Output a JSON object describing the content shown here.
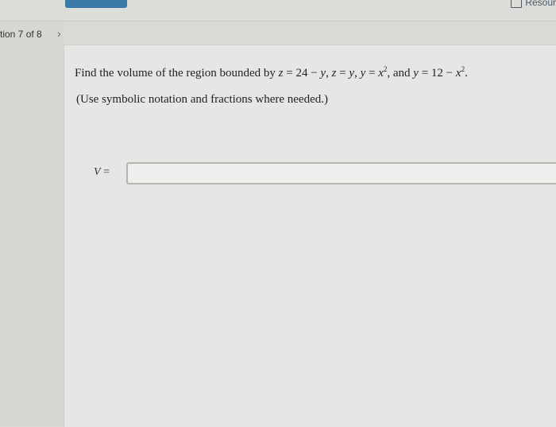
{
  "header": {
    "resources_label": "Resour"
  },
  "sidebar": {
    "question_nav": "tion 7 of 8",
    "next_arrow": "›"
  },
  "question": {
    "prefix": "Find the volume of the region bounded by ",
    "v_z": "z",
    "eq1": " = 24 − ",
    "v_y1": "y",
    "sep1": ", ",
    "v_z2": "z",
    "eq2": " = ",
    "v_y2": "y",
    "sep2": ", ",
    "v_y3": "y",
    "eq3": " = ",
    "v_x1": "x",
    "exp1": "2",
    "sep3": ", and ",
    "v_y4": "y",
    "eq4": " = 12 − ",
    "v_x2": "x",
    "exp2": "2",
    "end": "."
  },
  "note": "(Use symbolic notation and fractions where needed.)",
  "answer": {
    "label_var": "V",
    "label_eq": " =",
    "value": ""
  }
}
